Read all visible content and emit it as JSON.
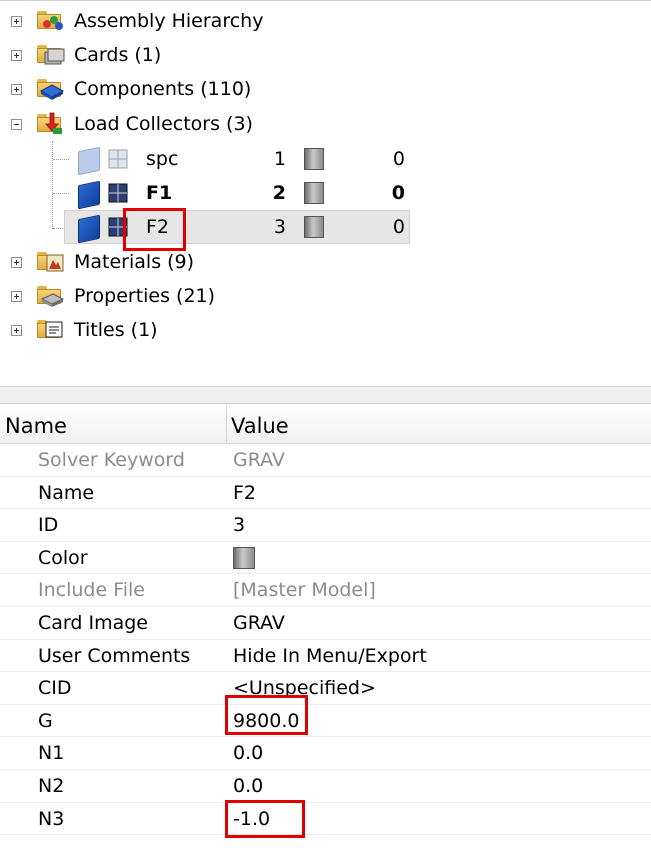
{
  "tree": {
    "items": [
      {
        "label": "Assembly Hierarchy",
        "icon": "assembly-hierarchy-icon",
        "expanded": false
      },
      {
        "label": "Cards (1)",
        "icon": "cards-icon",
        "expanded": false
      },
      {
        "label": "Components (110)",
        "icon": "components-icon",
        "expanded": false
      },
      {
        "label": "Load Collectors (3)",
        "icon": "load-collectors-icon",
        "expanded": true
      },
      {
        "label": "Materials (9)",
        "icon": "materials-icon",
        "expanded": false
      },
      {
        "label": "Properties (21)",
        "icon": "properties-icon",
        "expanded": false
      },
      {
        "label": "Titles (1)",
        "icon": "titles-icon",
        "expanded": false
      }
    ],
    "load_collectors": [
      {
        "name": "spc",
        "id": "1",
        "include": "0",
        "active": false
      },
      {
        "name": "F1",
        "id": "2",
        "include": "0",
        "active": true,
        "bold": true
      },
      {
        "name": "F2",
        "id": "3",
        "include": "0",
        "active": true,
        "selected": true
      }
    ]
  },
  "properties": {
    "header": {
      "name": "Name",
      "value": "Value"
    },
    "rows": [
      {
        "key": "Solver Keyword",
        "value": "GRAV",
        "disabled": true
      },
      {
        "key": "Name",
        "value": "F2"
      },
      {
        "key": "ID",
        "value": "3"
      },
      {
        "key": "Color",
        "value": "",
        "swatch": "#9a9a9a"
      },
      {
        "key": "Include File",
        "value": "[Master Model]",
        "disabled": true
      },
      {
        "key": "Card Image",
        "value": "GRAV"
      },
      {
        "key": "User Comments",
        "value": "Hide In Menu/Export"
      },
      {
        "key": "CID",
        "value": "<Unspecified>"
      },
      {
        "key": "G",
        "value": "9800.0"
      },
      {
        "key": "N1",
        "value": "0.0"
      },
      {
        "key": "N2",
        "value": "0.0"
      },
      {
        "key": "N3",
        "value": "-1.0"
      }
    ]
  },
  "colors": {
    "highlight": "#e00000",
    "selection": "#e6e6e6",
    "load_collector_blue": "#1f5fc9"
  }
}
